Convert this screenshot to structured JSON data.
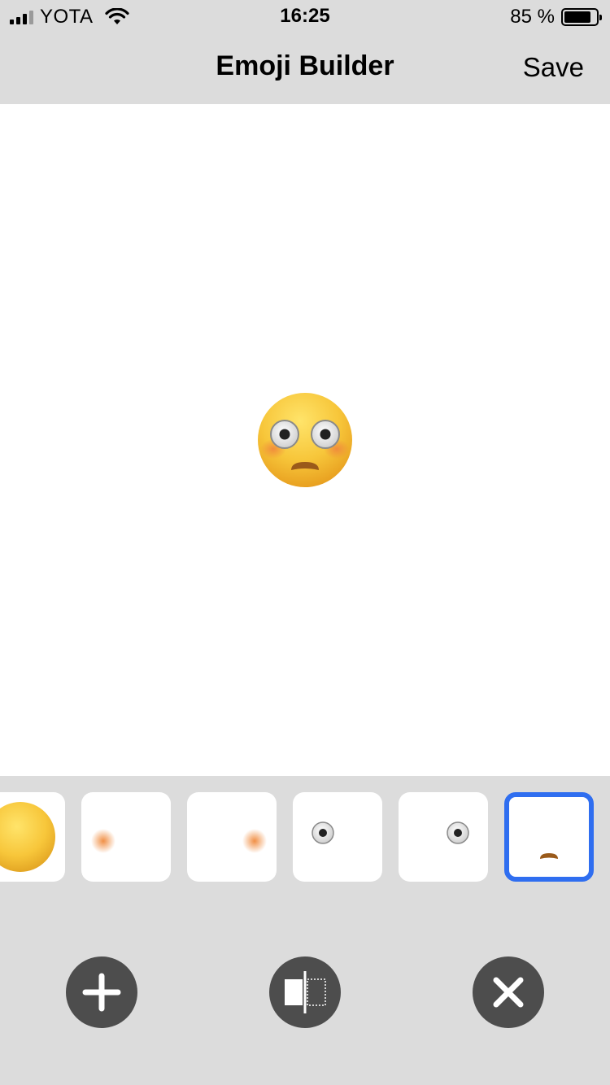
{
  "status_bar": {
    "carrier": "YOTA",
    "time": "16:25",
    "battery_percent_label": "85 %",
    "battery_level": 0.85,
    "icons": [
      "signal-icon",
      "wifi-icon",
      "battery-icon"
    ]
  },
  "nav": {
    "title": "Emoji Builder",
    "save_label": "Save"
  },
  "canvas": {
    "emoji_parts": [
      "face-yellow",
      "blush-left",
      "blush-right",
      "eye-left",
      "eye-right",
      "mouth-brown"
    ]
  },
  "parts": [
    {
      "name": "face-part",
      "selected": false
    },
    {
      "name": "blush-left-part",
      "selected": false
    },
    {
      "name": "blush-right-part",
      "selected": false
    },
    {
      "name": "eye-left-part",
      "selected": false
    },
    {
      "name": "eye-right-part",
      "selected": false
    },
    {
      "name": "mouth-part",
      "selected": true
    }
  ],
  "actions": {
    "add": "plus-icon",
    "mirror": "mirror-flip-icon",
    "delete": "close-icon"
  },
  "colors": {
    "selection_accent": "#2f6ef0",
    "action_button": "#4d4d4d",
    "toolbar_background": "#dcdcdc",
    "canvas_background": "#ffffff",
    "face_yellow": "#f7c63a",
    "blush": "#f08a3c",
    "mouth": "#9a5a1a"
  }
}
